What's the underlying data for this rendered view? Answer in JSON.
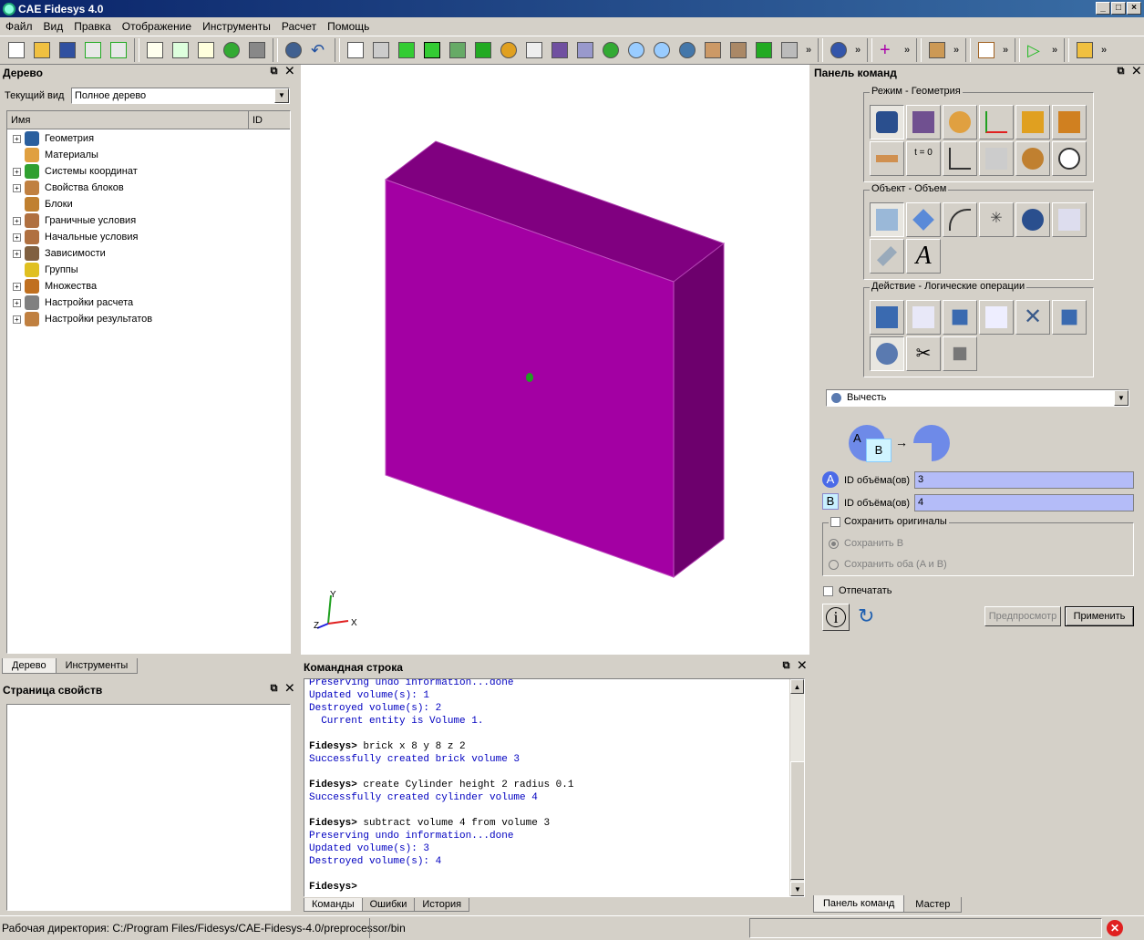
{
  "window": {
    "title": "CAE Fidesys 4.0"
  },
  "menu": [
    "Файл",
    "Вид",
    "Правка",
    "Отображение",
    "Инструменты",
    "Расчет",
    "Помощь"
  ],
  "tree_panel": {
    "title": "Дерево",
    "view_label": "Текущий вид",
    "view_value": "Полное дерево",
    "col_name": "Имя",
    "col_id": "ID",
    "items": [
      {
        "label": "Геометрия",
        "icon": "geometry-icon",
        "color": "#2a5f9e",
        "expandable": true
      },
      {
        "label": "Материалы",
        "icon": "materials-icon",
        "color": "#e0a040",
        "expandable": false
      },
      {
        "label": "Системы координат",
        "icon": "axes-icon",
        "color": "#30a030",
        "expandable": true
      },
      {
        "label": "Свойства блоков",
        "icon": "block-props-icon",
        "color": "#c08040",
        "expandable": true
      },
      {
        "label": "Блоки",
        "icon": "blocks-icon",
        "color": "#c08030",
        "expandable": false
      },
      {
        "label": "Граничные условия",
        "icon": "bc-icon",
        "color": "#b07040",
        "expandable": true
      },
      {
        "label": "Начальные условия",
        "icon": "ic-icon",
        "color": "#b07040",
        "expandable": true
      },
      {
        "label": "Зависимости",
        "icon": "dependency-icon",
        "color": "#806040",
        "expandable": true
      },
      {
        "label": "Группы",
        "icon": "groups-icon",
        "color": "#e0c020",
        "expandable": false
      },
      {
        "label": "Множества",
        "icon": "sets-icon",
        "color": "#c07020",
        "expandable": true
      },
      {
        "label": "Настройки расчета",
        "icon": "calc-settings-icon",
        "color": "#808080",
        "expandable": true
      },
      {
        "label": "Настройки результатов",
        "icon": "results-settings-icon",
        "color": "#c08040",
        "expandable": true
      }
    ],
    "tabs": [
      "Дерево",
      "Инструменты"
    ]
  },
  "props_panel": {
    "title": "Страница свойств"
  },
  "viewport": {
    "axis_x": "X",
    "axis_y": "Y",
    "axis_z": "Z",
    "box_color": "#a300a3"
  },
  "command_panel": {
    "title": "Командная строка",
    "lines": [
      {
        "text": "Preserving undo information...done",
        "style": "blue"
      },
      {
        "text": "Updated volume(s): 1",
        "style": "blue"
      },
      {
        "text": "Destroyed volume(s): 2",
        "style": "blue"
      },
      {
        "text": "  Current entity is Volume 1.",
        "style": "blue"
      },
      {
        "text": "",
        "style": "blue"
      },
      {
        "prompt": "Fidesys>",
        "text": " brick x 8 y 8 z 2",
        "style": "cmd"
      },
      {
        "text": "Successfully created brick volume 3",
        "style": "blue"
      },
      {
        "text": "",
        "style": "blue"
      },
      {
        "prompt": "Fidesys>",
        "text": " create Cylinder height 2 radius 0.1",
        "style": "cmd"
      },
      {
        "text": "Successfully created cylinder volume 4",
        "style": "blue"
      },
      {
        "text": "",
        "style": "blue"
      },
      {
        "prompt": "Fidesys>",
        "text": " subtract volume 4 from volume 3",
        "style": "cmd"
      },
      {
        "text": "Preserving undo information...done",
        "style": "blue"
      },
      {
        "text": "Updated volume(s): 3",
        "style": "blue"
      },
      {
        "text": "Destroyed volume(s): 4",
        "style": "blue"
      },
      {
        "text": "",
        "style": "blue"
      },
      {
        "prompt": "Fidesys>",
        "text": "",
        "style": "cmd"
      }
    ],
    "tabs": [
      "Команды",
      "Ошибки",
      "История"
    ]
  },
  "right_panel": {
    "title": "Панель команд",
    "group_mode": "Режим - Геометрия",
    "group_object": "Объект - Объем",
    "group_action": "Действие - Логические операции",
    "operation": "Вычесть",
    "diagram_a": "A",
    "diagram_b": "B",
    "field_a_label": "ID объёма(ов)",
    "field_a_value": "3",
    "field_b_label": "ID объёма(ов)",
    "field_b_value": "4",
    "keep_originals": "Сохранить оригиналы",
    "keep_b": "Сохранить B",
    "keep_both": "Сохранить оба (A и B)",
    "imprint": "Отпечатать",
    "preview_btn": "Предпросмотр",
    "apply_btn": "Применить",
    "tabs": [
      "Панель команд",
      "Мастер"
    ]
  },
  "status": {
    "workdir": "Рабочая директория: C:/Program Files/Fidesys/CAE-Fidesys-4.0/preprocessor/bin"
  }
}
